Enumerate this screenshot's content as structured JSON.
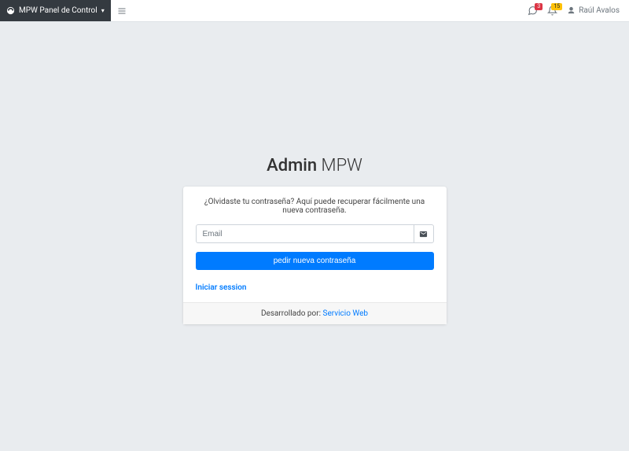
{
  "brand": {
    "label": "MPW Panel de Control"
  },
  "notifications": {
    "chat_count": "3",
    "alerts_count": "15"
  },
  "user": {
    "name": "Raúl Avalos"
  },
  "logo": {
    "bold": "Admin",
    "light": "MPW"
  },
  "card": {
    "message": "¿Olvidaste tu contraseña? Aquí puede recuperar fácilmente una nueva contraseña.",
    "email_placeholder": "Email",
    "submit_label": "pedir nueva contraseña",
    "login_link": "Iniciar session",
    "footer_prefix": "Desarrollado por: ",
    "footer_link": "Servicio Web"
  }
}
